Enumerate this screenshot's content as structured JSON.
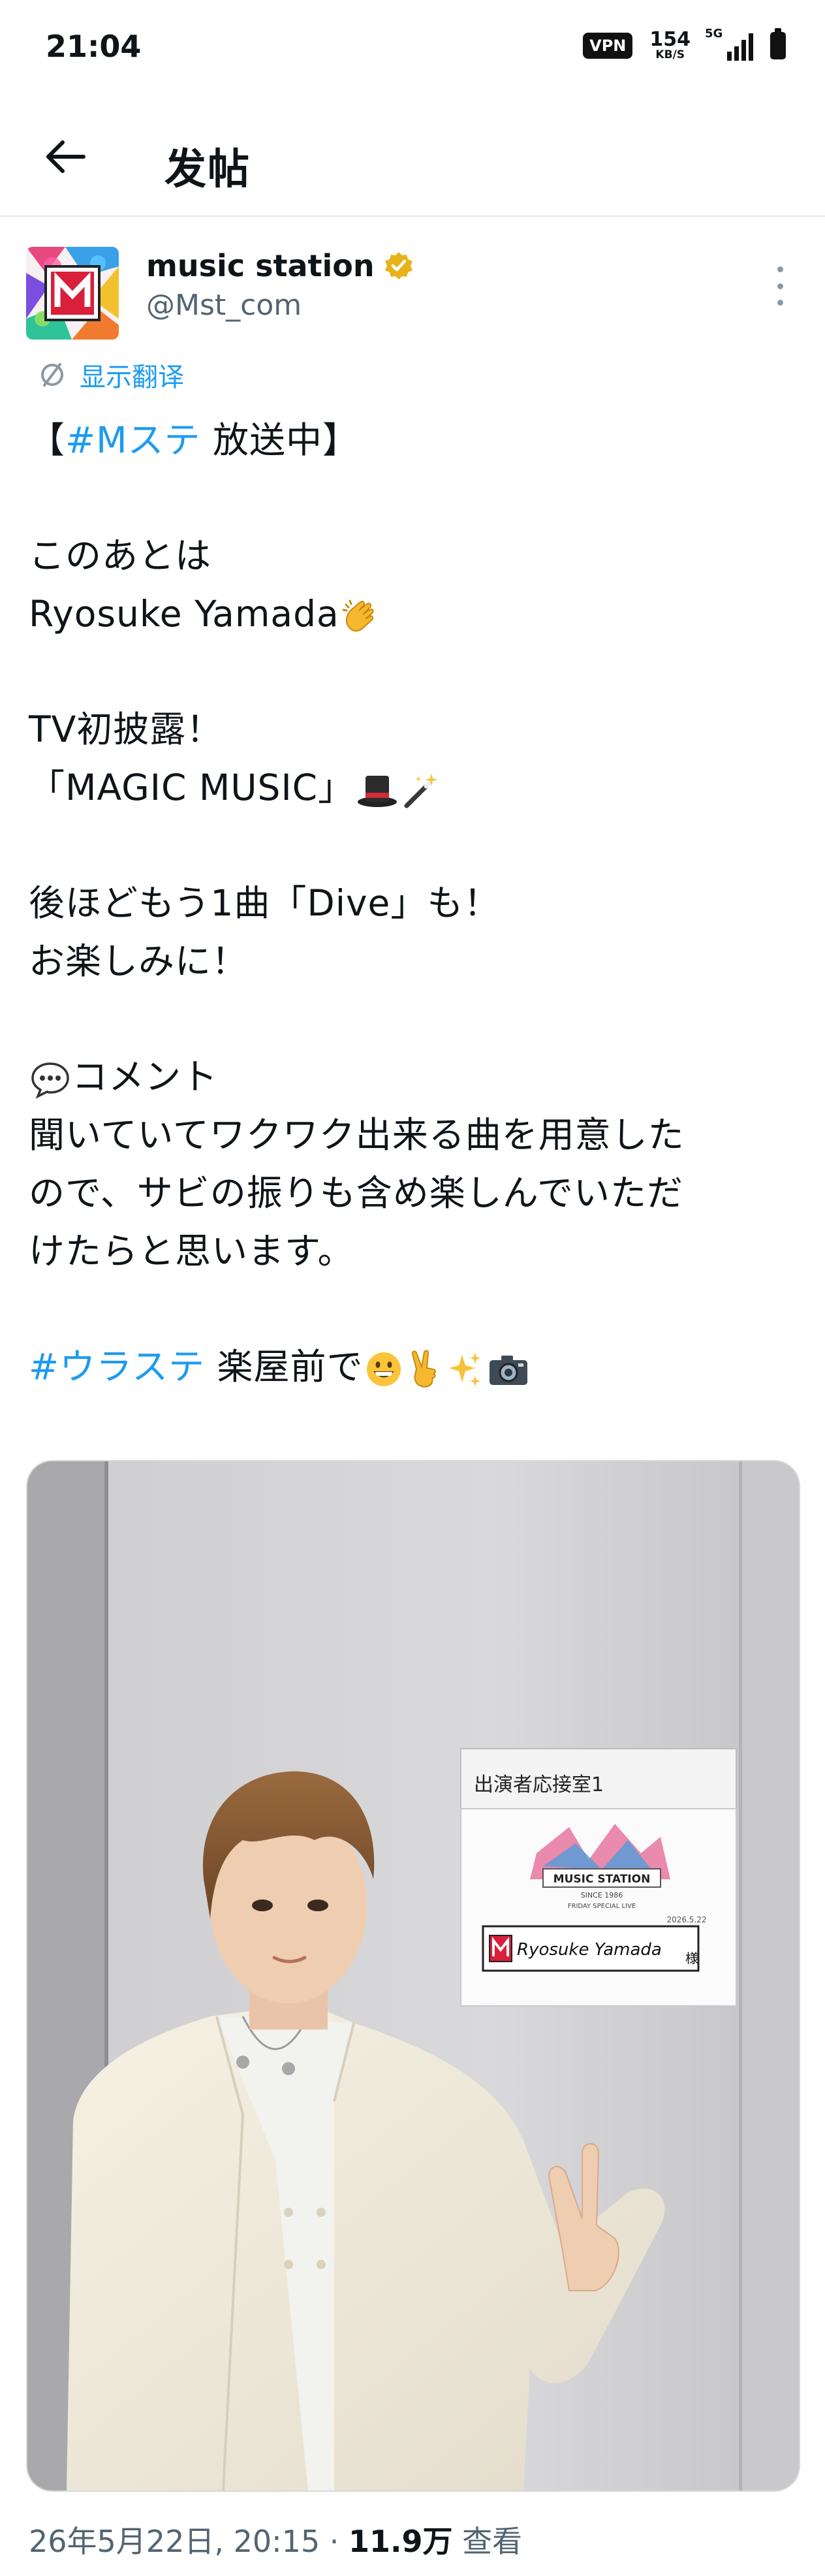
{
  "status_bar": {
    "time": "21:04",
    "vpn": "VPN",
    "speed_value": "154",
    "speed_unit": "KB/S",
    "network": "5G",
    "icons": [
      "vpn-icon",
      "signal-icon",
      "battery-icon"
    ]
  },
  "header": {
    "title": "发帖",
    "back_icon": "arrow-left-icon"
  },
  "post": {
    "author_name": "music station",
    "verified_icon": "verified-badge-icon",
    "handle": "@Mst_com",
    "translate_label": "显示翻译",
    "lines": [
      {
        "pre": "【",
        "tag": "#Mステ",
        "post": " 放送中】"
      },
      "このあとは",
      "Ryosuke Yamada",
      "TV初披露！",
      "「MAGIC MUSIC」",
      "後ほどもう1曲「Dive」も！",
      "お楽しみに！",
      "コメント",
      "聞いていてワクワク出来る曲を用意した",
      "ので、サビの振りも含め楽しんでいただ",
      "けたらと思います。",
      {
        "tag": "#ウラステ",
        "post": " 楽屋前で"
      }
    ],
    "emoji": [
      "clapping-hands-icon",
      "top-hat-icon",
      "magic-wand-icon",
      "speech-bubble-icon",
      "grinning-face-icon",
      "victory-hand-icon",
      "sparkles-icon",
      "camera-icon"
    ],
    "photo": {
      "sign_header": "出演者応接室1",
      "logo_text": "MUSIC STATION",
      "since": "SINCE 1986",
      "subtitle": "FRIDAY SPECIAL LIVE",
      "date": "2026.5.22",
      "name": "Ryosuke Yamada",
      "honorific": "様"
    },
    "timestamp": "26年5月22日, 20:15",
    "separator": "·",
    "views_count": "11.9万",
    "views_label": "查看"
  },
  "colors": {
    "accent": "#1d9bf0",
    "text": "#0f1419",
    "secondary": "#536471",
    "verified_gold": "#e8b31a"
  }
}
